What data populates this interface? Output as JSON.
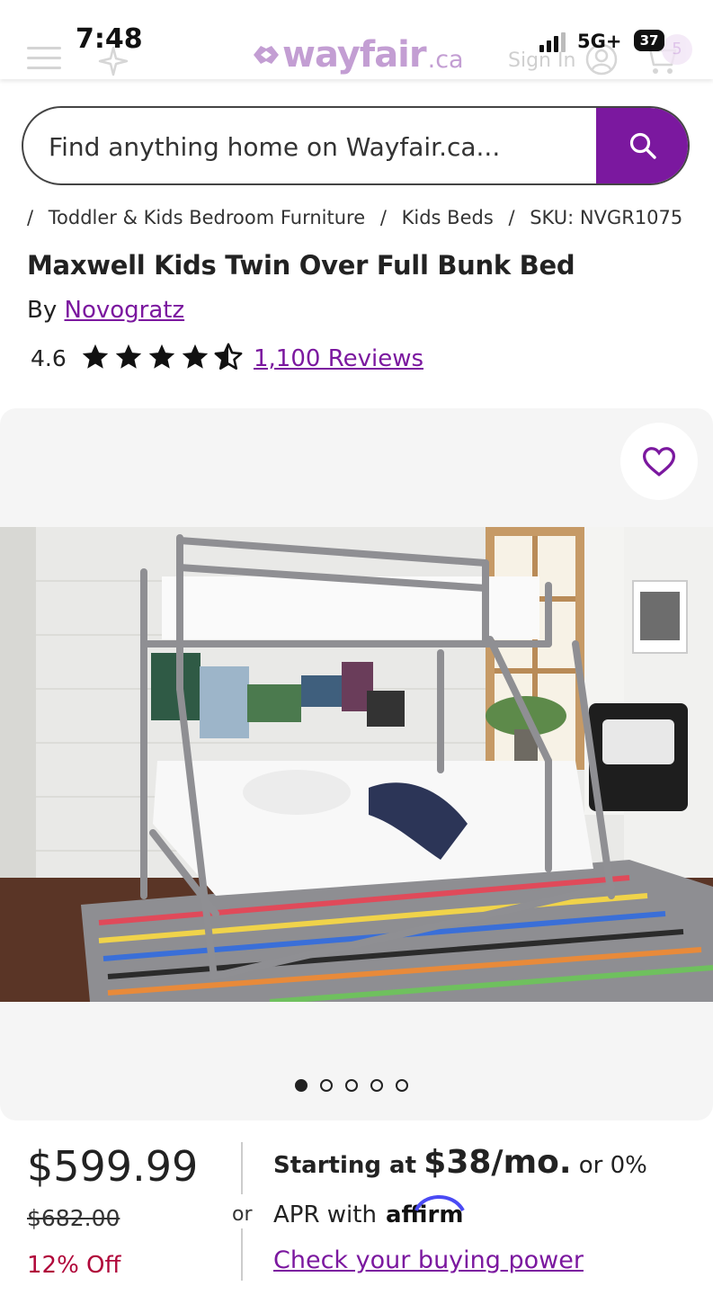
{
  "status_bar": {
    "time": "7:48",
    "network": "5G+",
    "battery": "37"
  },
  "header": {
    "logo_word": "wayfair",
    "logo_tld": ".ca",
    "sign_in": "Sign In",
    "cart_count": "5"
  },
  "search": {
    "placeholder": "Find anything home on Wayfair.ca..."
  },
  "breadcrumb": {
    "items": [
      "Toddler & Kids Bedroom Furniture",
      "Kids Beds",
      "SKU: NVGR1075"
    ]
  },
  "product": {
    "title": "Maxwell Kids Twin Over Full Bunk Bed",
    "by_label": "By",
    "brand": "Novogratz",
    "rating": "4.6",
    "reviews_label": "1,100 Reviews"
  },
  "gallery": {
    "slide_count": 5,
    "active_slide": 1
  },
  "pricing": {
    "price": "$599.99",
    "original_price": "$682.00",
    "discount": "12% Off",
    "or_label": "or",
    "starting_label": "Starting at",
    "monthly": "$38/mo.",
    "or_zero": "or 0%",
    "apr_label": "APR with",
    "affirm_brand": "affirm",
    "buying_power_link": "Check your buying power"
  },
  "colors": {
    "brand_purple": "#7b189f",
    "discount_red": "#b0073a"
  }
}
